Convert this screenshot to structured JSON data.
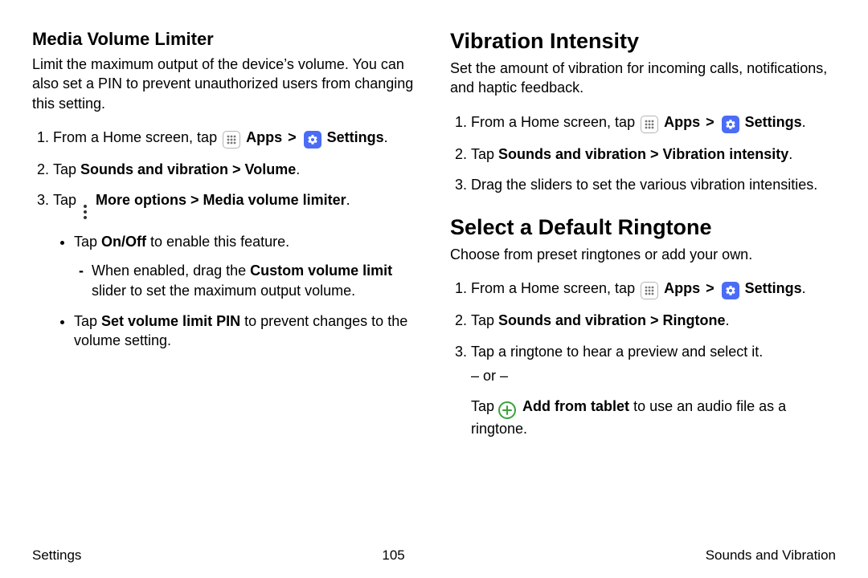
{
  "icons": {
    "apps_label": "Apps",
    "settings_label": "Settings",
    "more_options_label": "More options",
    "add_from_tablet_label": "Add from tablet"
  },
  "left": {
    "heading": "Media Volume Limiter",
    "intro": "Limit the maximum output of the device’s volume. You can also set a PIN to prevent unauthorized users from changing this setting.",
    "step1_prefix": "From a Home screen, tap ",
    "step1_chev": ">",
    "step1_end": ".",
    "step2_prefix": "Tap ",
    "step2_bold": "Sounds and vibration > Volume",
    "step2_end": ".",
    "step3_prefix": "Tap ",
    "step3_bold": "More options > Media volume limiter",
    "step3_end": ".",
    "b1_prefix": "Tap ",
    "b1_bold": "On/Off",
    "b1_suffix": " to enable this feature.",
    "b1a_prefix": "When enabled, drag the ",
    "b1a_bold": "Custom volume limit",
    "b1a_suffix": " slider to set the maximum output volume.",
    "b2_prefix": "Tap ",
    "b2_bold": "Set volume limit PIN",
    "b2_suffix": " to prevent changes to the volume setting."
  },
  "right": {
    "h1": {
      "heading": "Vibration Intensity",
      "intro": "Set the amount of vibration for incoming calls, notifications, and haptic feedback.",
      "step1_prefix": "From a Home screen, tap ",
      "step1_chev": ">",
      "step1_end": ".",
      "step2_prefix": "Tap ",
      "step2_bold": "Sounds and vibration > Vibration intensity",
      "step2_end": ".",
      "step3": "Drag the sliders to set the various vibration intensities."
    },
    "h2": {
      "heading": "Select a Default Ringtone",
      "intro": "Choose from preset ringtones or add your own.",
      "step1_prefix": "From a Home screen, tap ",
      "step1_chev": ">",
      "step1_end": ".",
      "step2_prefix": "Tap ",
      "step2_bold": "Sounds and vibration > Ringtone",
      "step2_end": ".",
      "step3": "Tap a ringtone to hear a preview and select it.",
      "or": "– or –",
      "step3b_prefix": "Tap ",
      "step3b_suffix": " to use an audio file as a ringtone."
    }
  },
  "footer": {
    "left": "Settings",
    "center": "105",
    "right": "Sounds and Vibration"
  }
}
